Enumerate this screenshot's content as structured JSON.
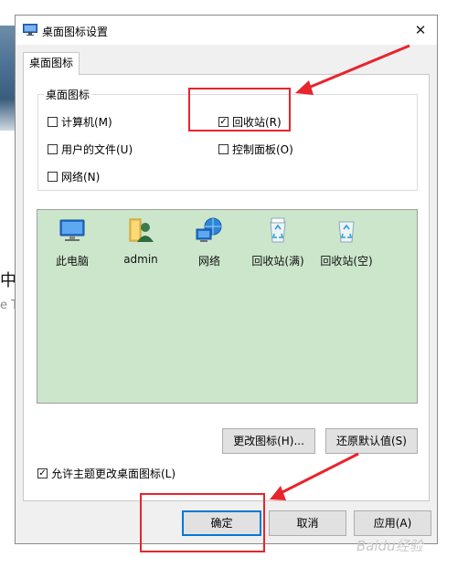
{
  "window": {
    "title": "桌面图标设置",
    "close_glyph": "✕"
  },
  "tab": {
    "label": "桌面图标"
  },
  "group": {
    "legend": "桌面图标",
    "checkboxes": [
      {
        "label": "计算机(M)",
        "checked": false
      },
      {
        "label": "回收站(R)",
        "checked": true
      },
      {
        "label": "用户的文件(U)",
        "checked": false
      },
      {
        "label": "控制面板(O)",
        "checked": false
      },
      {
        "label": "网络(N)",
        "checked": false
      }
    ]
  },
  "preview": {
    "icons": [
      {
        "label": "此电脑",
        "icon": "computer-icon"
      },
      {
        "label": "admin",
        "icon": "user-folder-icon"
      },
      {
        "label": "网络",
        "icon": "network-icon"
      },
      {
        "label": "回收站(满)",
        "icon": "recycle-bin-full-icon"
      },
      {
        "label": "回收站(空)",
        "icon": "recycle-bin-empty-icon"
      }
    ]
  },
  "buttons": {
    "change_icon": "更改图标(H)...",
    "restore_default": "还原默认值(S)",
    "ok": "确定",
    "cancel": "取消",
    "apply": "应用(A)"
  },
  "allow_themes": {
    "label": "允许主题更改桌面图标(L)",
    "checked": true
  },
  "background": {
    "text_1": "中",
    "text_2": "e T"
  },
  "watermark": "Baidu经验",
  "colors": {
    "annotation": "#e8242c",
    "preview_bg": "#cbe6cb",
    "accent": "#0078d7"
  }
}
